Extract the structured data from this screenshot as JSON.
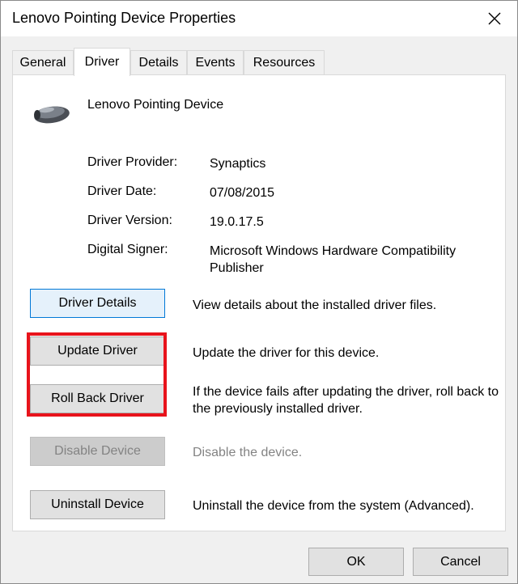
{
  "window": {
    "title": "Lenovo Pointing Device Properties"
  },
  "tabs": [
    "General",
    "Driver",
    "Details",
    "Events",
    "Resources"
  ],
  "device": {
    "name": "Lenovo Pointing Device"
  },
  "properties": [
    {
      "label": "Driver Provider:",
      "value": "Synaptics"
    },
    {
      "label": "Driver Date:",
      "value": "07/08/2015"
    },
    {
      "label": "Driver Version:",
      "value": "19.0.17.5"
    },
    {
      "label": "Digital Signer:",
      "value": "Microsoft Windows Hardware Compatibility Publisher"
    }
  ],
  "actions": [
    {
      "button": "Driver Details",
      "description": "View details about the installed driver files."
    },
    {
      "button": "Update Driver",
      "description": "Update the driver for this device."
    },
    {
      "button": "Roll Back Driver",
      "description": "If the device fails after updating the driver, roll back to the previously installed driver."
    },
    {
      "button": "Disable Device",
      "description": "Disable the device."
    },
    {
      "button": "Uninstall Device",
      "description": "Uninstall the device from the system (Advanced)."
    }
  ],
  "footer": {
    "ok": "OK",
    "cancel": "Cancel"
  },
  "colors": {
    "highlight": "#e8131b",
    "focus": "#0078d7"
  }
}
